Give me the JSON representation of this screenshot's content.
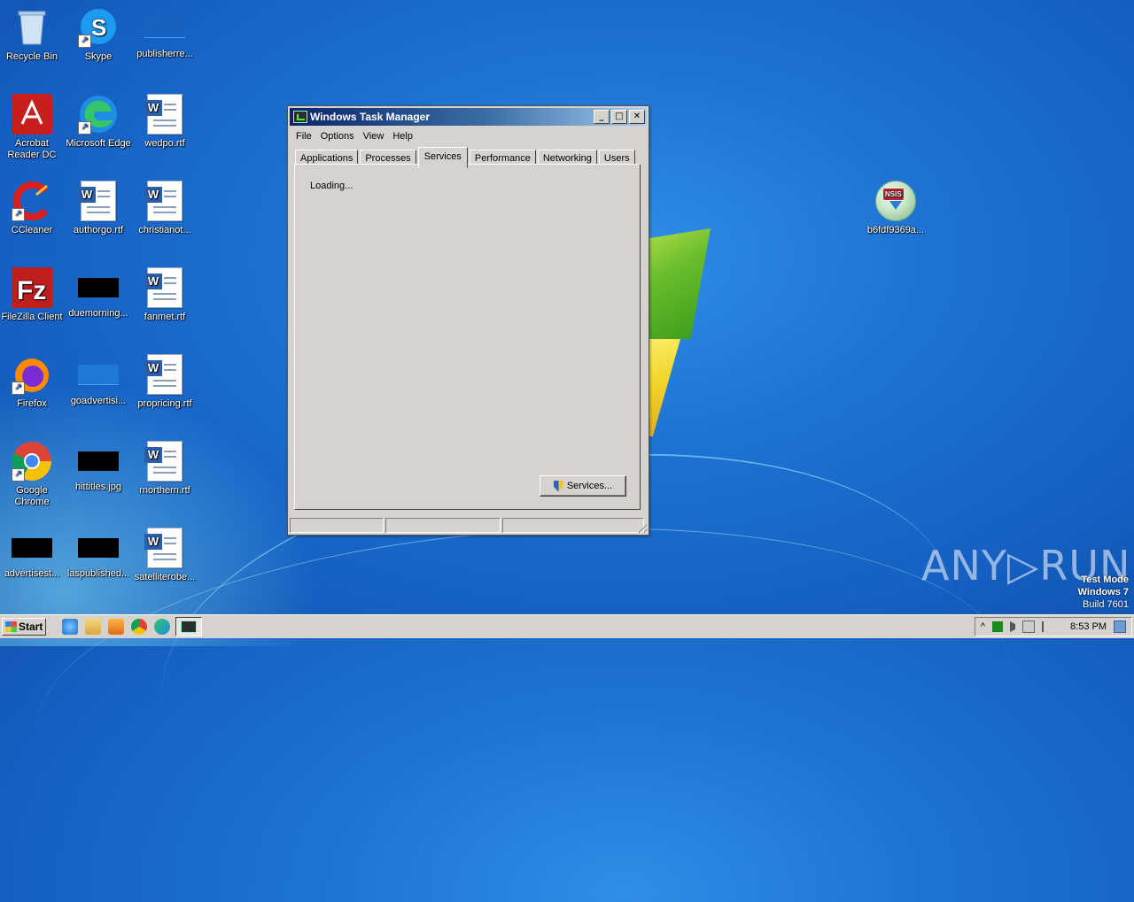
{
  "desktop": {
    "icons": [
      {
        "label": "Recycle Bin"
      },
      {
        "label": "Skype"
      },
      {
        "label": "publisherre..."
      },
      {
        "label": "Acrobat Reader DC"
      },
      {
        "label": "Microsoft Edge"
      },
      {
        "label": "wedpo.rtf"
      },
      {
        "label": "CCleaner"
      },
      {
        "label": "authorgo.rtf"
      },
      {
        "label": "christianot..."
      },
      {
        "label": "FileZilla Client"
      },
      {
        "label": "duemorning..."
      },
      {
        "label": "fanmet.rtf"
      },
      {
        "label": "Firefox"
      },
      {
        "label": "goadvertisi..."
      },
      {
        "label": "propricing.rtf"
      },
      {
        "label": "Google Chrome"
      },
      {
        "label": "hittitles.jpg"
      },
      {
        "label": "rnorthern.rtf"
      },
      {
        "label": "advertisest..."
      },
      {
        "label": "laspublished..."
      },
      {
        "label": "satelliterobe..."
      },
      {
        "label": "b6fdf9369a..."
      }
    ],
    "watermark": "ANY▷RUN",
    "test_mode": {
      "line1": "Test Mode",
      "line2": "Windows 7",
      "line3": "Build 7601"
    }
  },
  "window": {
    "title": "Windows Task Manager",
    "controls": {
      "minimize": "_",
      "maximize": "□",
      "close": "✕"
    },
    "menu": [
      "File",
      "Options",
      "View",
      "Help"
    ],
    "tabs": [
      {
        "label": "Applications",
        "active": false
      },
      {
        "label": "Processes",
        "active": false
      },
      {
        "label": "Services",
        "active": true
      },
      {
        "label": "Performance",
        "active": false
      },
      {
        "label": "Networking",
        "active": false
      },
      {
        "label": "Users",
        "active": false
      }
    ],
    "loading_text": "Loading...",
    "services_button": "Services..."
  },
  "taskbar": {
    "start_label": "Start",
    "clock": "8:53 PM",
    "tray_expand": "^"
  },
  "colors": {
    "titlebar_start": "#0a246a",
    "titlebar_end": "#a6caf0",
    "desktop": "#1e73d2",
    "window_face": "#d6d3ce"
  }
}
